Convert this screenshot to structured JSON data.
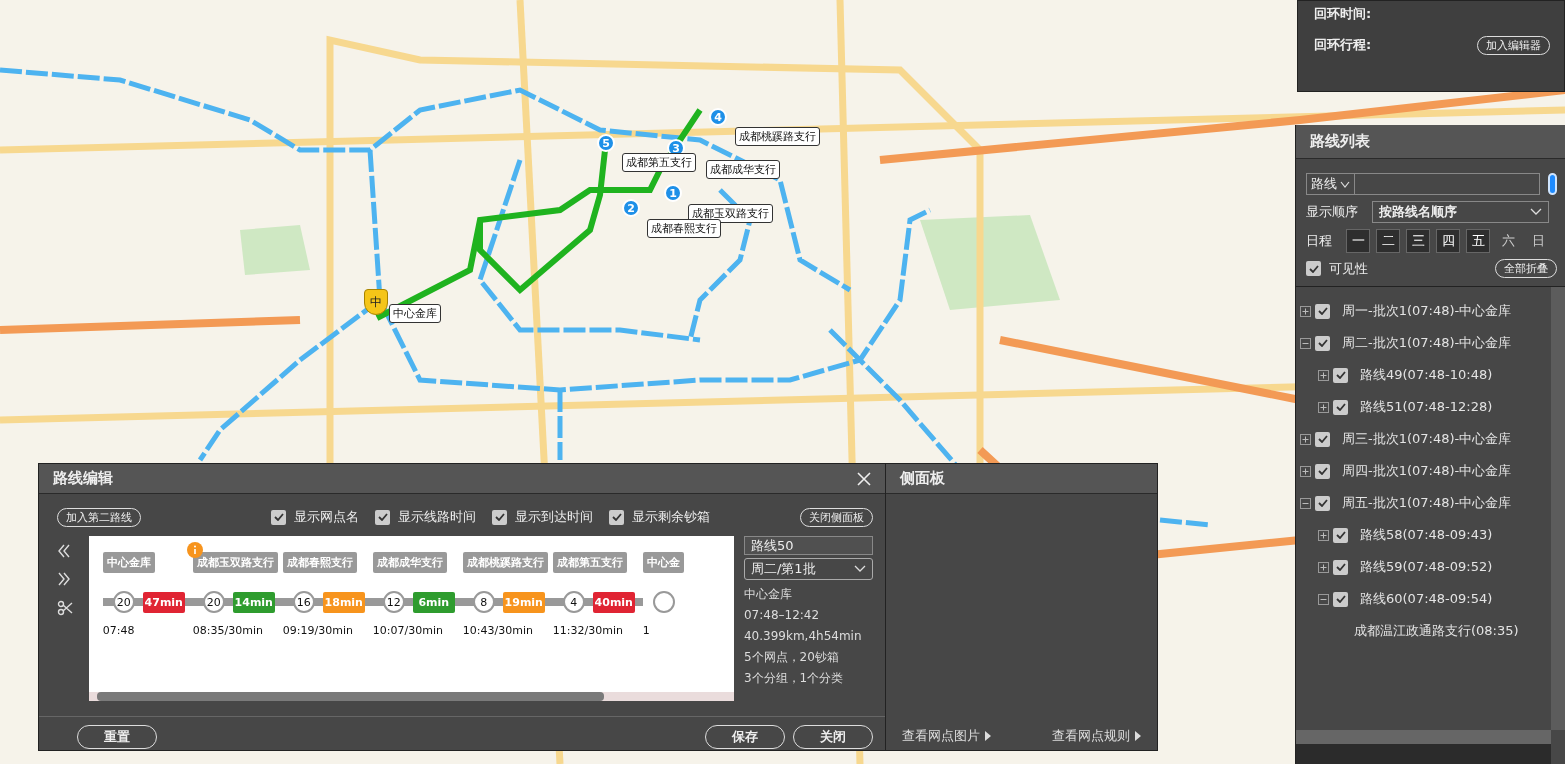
{
  "loop_panel": {
    "rows": [
      {
        "label": "回环时间:"
      },
      {
        "label": "回环行程:",
        "button": "加入编辑器"
      }
    ]
  },
  "map": {
    "markers": [
      "1",
      "2",
      "3",
      "4",
      "5"
    ],
    "labels": [
      "成都桃蹊路支行",
      "成都第五支行",
      "成都成华支行",
      "成都玉双路支行",
      "成都春熙支行",
      "中心金库"
    ],
    "depot_pin": "中"
  },
  "route_editor": {
    "title": "路线编辑",
    "second_route_button": "加入第二路线",
    "options": [
      {
        "label": "显示网点名",
        "checked": true
      },
      {
        "label": "显示线路时间",
        "checked": true
      },
      {
        "label": "显示到达时间",
        "checked": true
      },
      {
        "label": "显示剩余钞箱",
        "checked": true
      }
    ],
    "close_side_panel_button": "关闭侧面板",
    "stops": [
      {
        "name": "中心金库",
        "count": "20",
        "time": "07:48",
        "alert": false
      },
      {
        "name": "成都玉双路支行",
        "count": "20",
        "time": "08:35/30min",
        "alert": true
      },
      {
        "name": "成都春熙支行",
        "count": "16",
        "time": "09:19/30min",
        "alert": false
      },
      {
        "name": "成都成华支行",
        "count": "12",
        "time": "10:07/30min",
        "alert": false
      },
      {
        "name": "成都桃蹊路支行",
        "count": "8",
        "time": "10:43/30min",
        "alert": false
      },
      {
        "name": "成都第五支行",
        "count": "4",
        "time": "11:32/30min",
        "alert": false
      },
      {
        "name": "中心金",
        "time": "1",
        "alert": false
      }
    ],
    "legs": [
      {
        "duration": "47min",
        "color": "#e02433"
      },
      {
        "duration": "14min",
        "color": "#2e9c2e"
      },
      {
        "duration": "18min",
        "color": "#f7941d"
      },
      {
        "duration": "6min",
        "color": "#2e9c2e"
      },
      {
        "duration": "19min",
        "color": "#f7941d"
      },
      {
        "duration": "40min",
        "color": "#e02433"
      }
    ],
    "route_name": "路线50",
    "batch_select": "周二/第1批",
    "summary": [
      "中心金库",
      "07:48–12:42",
      "40.399km,4h54min",
      "5个网点，20钞箱",
      "3个分组，1个分类"
    ],
    "reset_button": "重置",
    "save_button": "保存",
    "close_button": "关闭"
  },
  "side_panel": {
    "title": "侧面板",
    "links": [
      "查看网点图片",
      "查看网点规则"
    ]
  },
  "route_list": {
    "title": "路线列表",
    "search_type": "路线",
    "order_label": "显示顺序",
    "order_select": "按路线名顺序",
    "schedule_label": "日程",
    "days": [
      {
        "label": "一",
        "selected": true
      },
      {
        "label": "二",
        "selected": true
      },
      {
        "label": "三",
        "selected": true
      },
      {
        "label": "四",
        "selected": true
      },
      {
        "label": "五",
        "selected": true
      },
      {
        "label": "六",
        "selected": false
      },
      {
        "label": "日",
        "selected": false
      }
    ],
    "visibility": {
      "label": "可见性",
      "checked": true
    },
    "collapse_all_button": "全部折叠",
    "tree": [
      {
        "label": "周一-批次1(07:48)-中心金库",
        "checked": true,
        "expanded": false
      },
      {
        "label": "周二-批次1(07:48)-中心金库",
        "checked": true,
        "expanded": true,
        "children": [
          {
            "label": "路线49(07:48-10:48)",
            "checked": true,
            "expanded": false
          },
          {
            "label": "路线51(07:48-12:28)",
            "checked": true,
            "expanded": false
          }
        ]
      },
      {
        "label": "周三-批次1(07:48)-中心金库",
        "checked": true,
        "expanded": false
      },
      {
        "label": "周四-批次1(07:48)-中心金库",
        "checked": true,
        "expanded": false
      },
      {
        "label": "周五-批次1(07:48)-中心金库",
        "checked": true,
        "expanded": true,
        "children": [
          {
            "label": "路线58(07:48-09:43)",
            "checked": true,
            "expanded": false
          },
          {
            "label": "路线59(07:48-09:52)",
            "checked": true,
            "expanded": false
          },
          {
            "label": "路线60(07:48-09:54)",
            "checked": true,
            "expanded": true,
            "children": [
              {
                "label": "成都温江政通路支行(08:35)"
              }
            ]
          }
        ]
      }
    ]
  }
}
